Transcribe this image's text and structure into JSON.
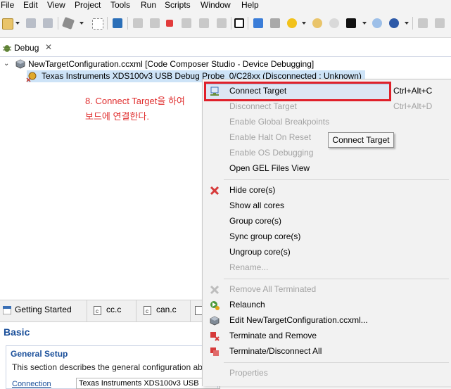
{
  "menubar": {
    "items": [
      "File",
      "Edit",
      "View",
      "Project",
      "Tools",
      "Run",
      "Scripts",
      "Window",
      "Help"
    ]
  },
  "debug_view": {
    "tab_label": "Debug",
    "tree": {
      "configuration": "NewTargetConfiguration.ccxml [Code Composer Studio - Device Debugging]",
      "probe": "Texas Instruments XDS100v3 USB Debug Probe_0/C28xx (Disconnected : Unknown)"
    }
  },
  "annotation": {
    "line1": "8. Connect Target을 하여",
    "line2": "보드에 연결한다."
  },
  "context_menu": {
    "items": [
      {
        "label": "Connect Target",
        "accel": "Ctrl+Alt+C",
        "enabled": true,
        "highlighted": true,
        "icon": "connect-target-icon"
      },
      {
        "label": "Disconnect Target",
        "accel": "Ctrl+Alt+D",
        "enabled": false,
        "icon": ""
      },
      {
        "label": "Enable Global Breakpoints",
        "accel": "",
        "enabled": false,
        "icon": ""
      },
      {
        "label": "Enable Halt On Reset",
        "accel": "",
        "enabled": false,
        "icon": ""
      },
      {
        "label": "Enable OS Debugging",
        "accel": "",
        "enabled": false,
        "icon": ""
      },
      {
        "label": "Open GEL Files View",
        "accel": "",
        "enabled": true,
        "icon": ""
      },
      {
        "label": "Hide core(s)",
        "accel": "",
        "enabled": true,
        "icon": "hide-core-icon"
      },
      {
        "label": "Show all cores",
        "accel": "",
        "enabled": true,
        "icon": ""
      },
      {
        "label": "Group core(s)",
        "accel": "",
        "enabled": true,
        "icon": ""
      },
      {
        "label": "Sync group core(s)",
        "accel": "",
        "enabled": true,
        "icon": ""
      },
      {
        "label": "Ungroup core(s)",
        "accel": "",
        "enabled": true,
        "icon": ""
      },
      {
        "label": "Rename...",
        "accel": "",
        "enabled": false,
        "icon": ""
      },
      {
        "label": "Remove All Terminated",
        "accel": "",
        "enabled": false,
        "icon": "remove-all-terminated-icon"
      },
      {
        "label": "Relaunch",
        "accel": "",
        "enabled": true,
        "icon": "relaunch-icon"
      },
      {
        "label": "Edit NewTargetConfiguration.ccxml...",
        "accel": "",
        "enabled": true,
        "icon": "edit-config-icon"
      },
      {
        "label": "Terminate and Remove",
        "accel": "",
        "enabled": true,
        "icon": "terminate-remove-icon"
      },
      {
        "label": "Terminate/Disconnect All",
        "accel": "",
        "enabled": true,
        "icon": "terminate-disconnect-all-icon"
      },
      {
        "label": "Properties",
        "accel": "",
        "enabled": false,
        "icon": ""
      }
    ]
  },
  "tooltip": {
    "text": "Connect Target"
  },
  "bottom_panel": {
    "tabs": [
      "Getting Started",
      "cc.c",
      "can.c"
    ],
    "basic_title": "Basic",
    "general_setup_title": "General Setup",
    "general_setup_desc": "This section describes the general configuration ab",
    "connection_label": "Connection",
    "connection_value": "Texas Instruments XDS100v3 USB"
  },
  "colors": {
    "annotation_red": "#e03030",
    "highlight_box_red": "#e0202a",
    "section_blue": "#1a4f9a"
  }
}
